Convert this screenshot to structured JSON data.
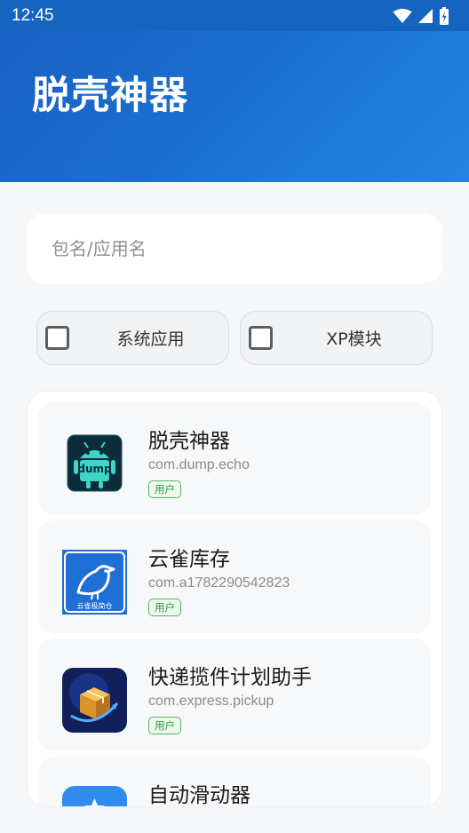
{
  "status_bar": {
    "time": "12:45",
    "icons": [
      "wifi-icon",
      "signal-icon",
      "battery-icon"
    ]
  },
  "header": {
    "title": "脱壳神器",
    "color_start": "#1a5fc2",
    "color_end": "#2384e0"
  },
  "search": {
    "placeholder": "包名/应用名",
    "value": ""
  },
  "filters": {
    "system_apps": {
      "label": "系统应用",
      "checked": false
    },
    "xp_modules": {
      "label": "XP模块",
      "checked": false
    }
  },
  "apps": [
    {
      "name": "脱壳神器",
      "package": "com.dump.echo",
      "badge": "用户",
      "icon": "android-dump-icon"
    },
    {
      "name": "云雀库存",
      "package": "com.a1782290542823",
      "badge": "用户",
      "icon": "bird-icon",
      "icon_caption": "云雀极简仓"
    },
    {
      "name": "快递揽件计划助手",
      "package": "com.express.pickup",
      "badge": "用户",
      "icon": "package-box-icon"
    },
    {
      "name": "自动滑动器",
      "package": "",
      "badge": "",
      "icon": "auto-slider-icon"
    }
  ]
}
